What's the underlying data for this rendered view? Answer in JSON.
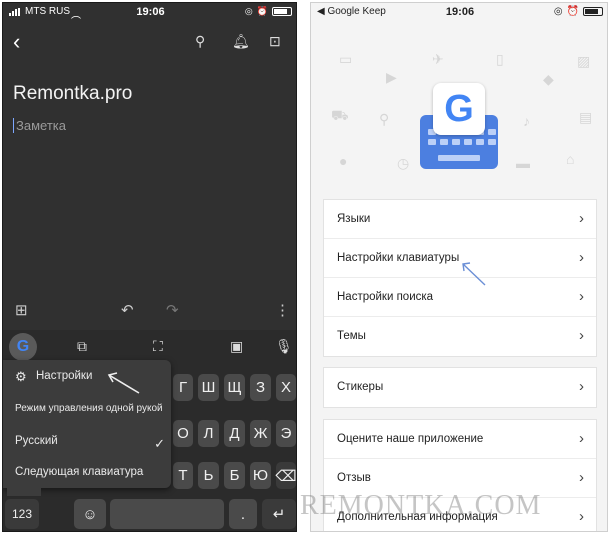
{
  "left_phone": {
    "status": {
      "carrier": "MTS RUS",
      "time": "19:06"
    },
    "toolbar": {
      "back_icon": "back-arrow-icon",
      "pin_icon": "pin-icon",
      "reminder_icon": "bell-icon",
      "archive_icon": "archive-icon"
    },
    "note": {
      "title": "Remontka.pro",
      "body_placeholder": "Заметка"
    },
    "bottom_bar": {
      "add_icon": "add-box-icon",
      "undo_icon": "undo-icon",
      "redo_icon": "redo-icon",
      "more_icon": "more-vert-icon"
    },
    "keyboard": {
      "google_label": "G",
      "keys_row1": [
        "Г",
        "Ш",
        "Щ",
        "З",
        "Х"
      ],
      "keys_row2": [
        "О",
        "Л",
        "Д",
        "Ж",
        "Э"
      ],
      "keys_row3": [
        "Т",
        "Ь",
        "Б",
        "Ю"
      ],
      "numbers_key": "123",
      "period_key": "."
    },
    "popup_menu": {
      "settings": "Настройки",
      "one_hand": "Режим управления одной рукой",
      "language": "Русский",
      "next_keyboard": "Следующая клавиатура"
    }
  },
  "right_phone": {
    "status": {
      "app": "◀ Google Keep",
      "time": "19:06"
    },
    "logo_letter": "G",
    "group1": [
      "Языки",
      "Настройки клавиатуры",
      "Настройки поиска",
      "Темы"
    ],
    "group2": [
      "Стикеры"
    ],
    "group3": [
      "Оцените наше приложение",
      "Отзыв",
      "Дополнительная информация"
    ]
  },
  "watermark": "REMONTKA.COM",
  "colors": {
    "accent_blue": "#4285f4",
    "keyboard_logo": "#4c7fe0",
    "arrow": "#6b8fd6"
  }
}
